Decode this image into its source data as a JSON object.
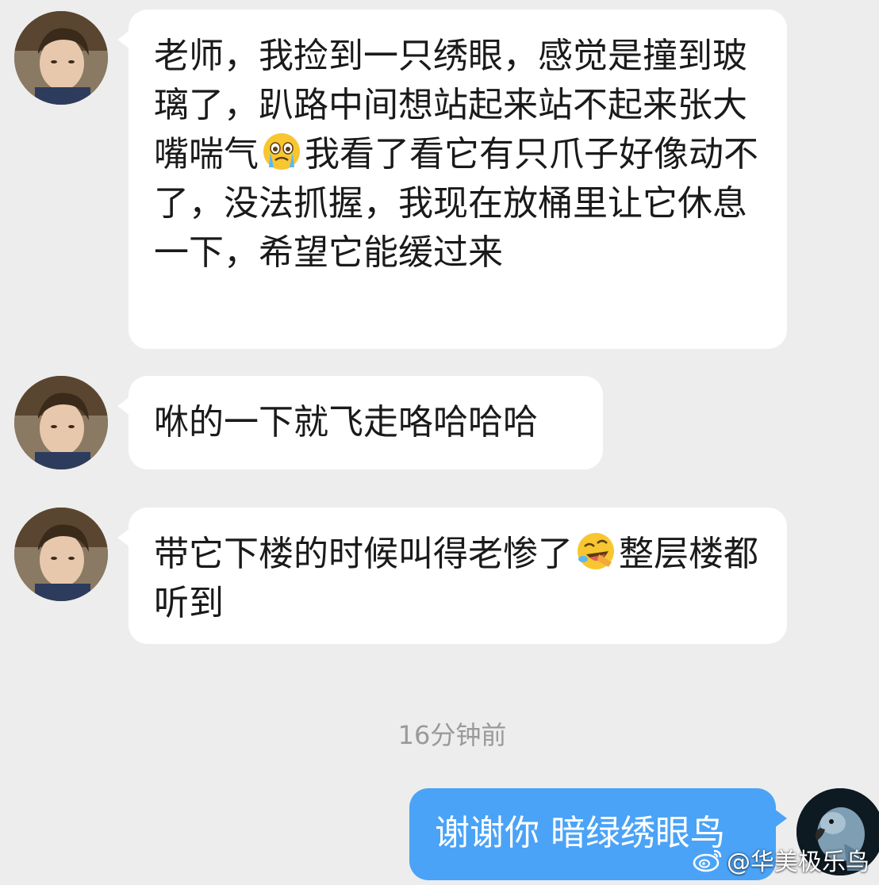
{
  "messages": [
    {
      "direction": "incoming",
      "parts": [
        "老师，我捡到一只绣眼，感觉是撞到玻璃了，趴路中间想站起来站不起来张大嘴喘气",
        "我看了看它有只爪子好像动不了，没法抓握，我现在放桶里让它休息一下，希望它能缓过来"
      ],
      "emoji": "crying-face-icon"
    },
    {
      "direction": "incoming",
      "text": "咻的一下就飞走咯哈哈哈"
    },
    {
      "direction": "incoming",
      "parts": [
        "带它下楼的时候叫得老惨了",
        "整层楼都听到"
      ],
      "emoji": "rolling-on-floor-laughing-icon"
    }
  ],
  "timestamp": "16分钟前",
  "reply": {
    "direction": "outgoing",
    "text": "谢谢你 暗绿绣眼鸟"
  },
  "watermark": {
    "text": "@华美极乐鸟",
    "logo": "weibo-logo-icon"
  },
  "colors": {
    "background": "#ededed",
    "incoming_bubble": "#ffffff",
    "outgoing_bubble": "#4aa3f7",
    "timestamp": "#9a9a9a"
  }
}
